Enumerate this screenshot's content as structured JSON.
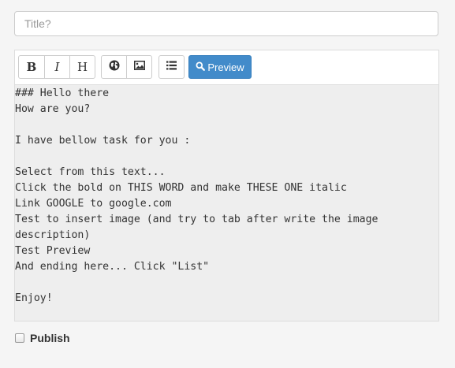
{
  "title_field": {
    "placeholder": "Title?",
    "value": ""
  },
  "toolbar": {
    "bold_label": "B",
    "italic_label": "I",
    "heading_label": "H",
    "link_icon": "globe-icon",
    "image_icon": "picture-icon",
    "list_icon": "list-icon",
    "preview_label": "Preview",
    "preview_icon": "search-icon",
    "preview_color": "#428bca"
  },
  "editor": {
    "content": "### Hello there\nHow are you?\n\nI have bellow task for you :\n\nSelect from this text...\nClick the bold on THIS WORD and make THESE ONE italic\nLink GOOGLE to google.com\nTest to insert image (and try to tab after write the image\ndescription)\nTest Preview\nAnd ending here... Click \"List\"\n\nEnjoy!"
  },
  "publish": {
    "label": "Publish",
    "checked": false
  }
}
